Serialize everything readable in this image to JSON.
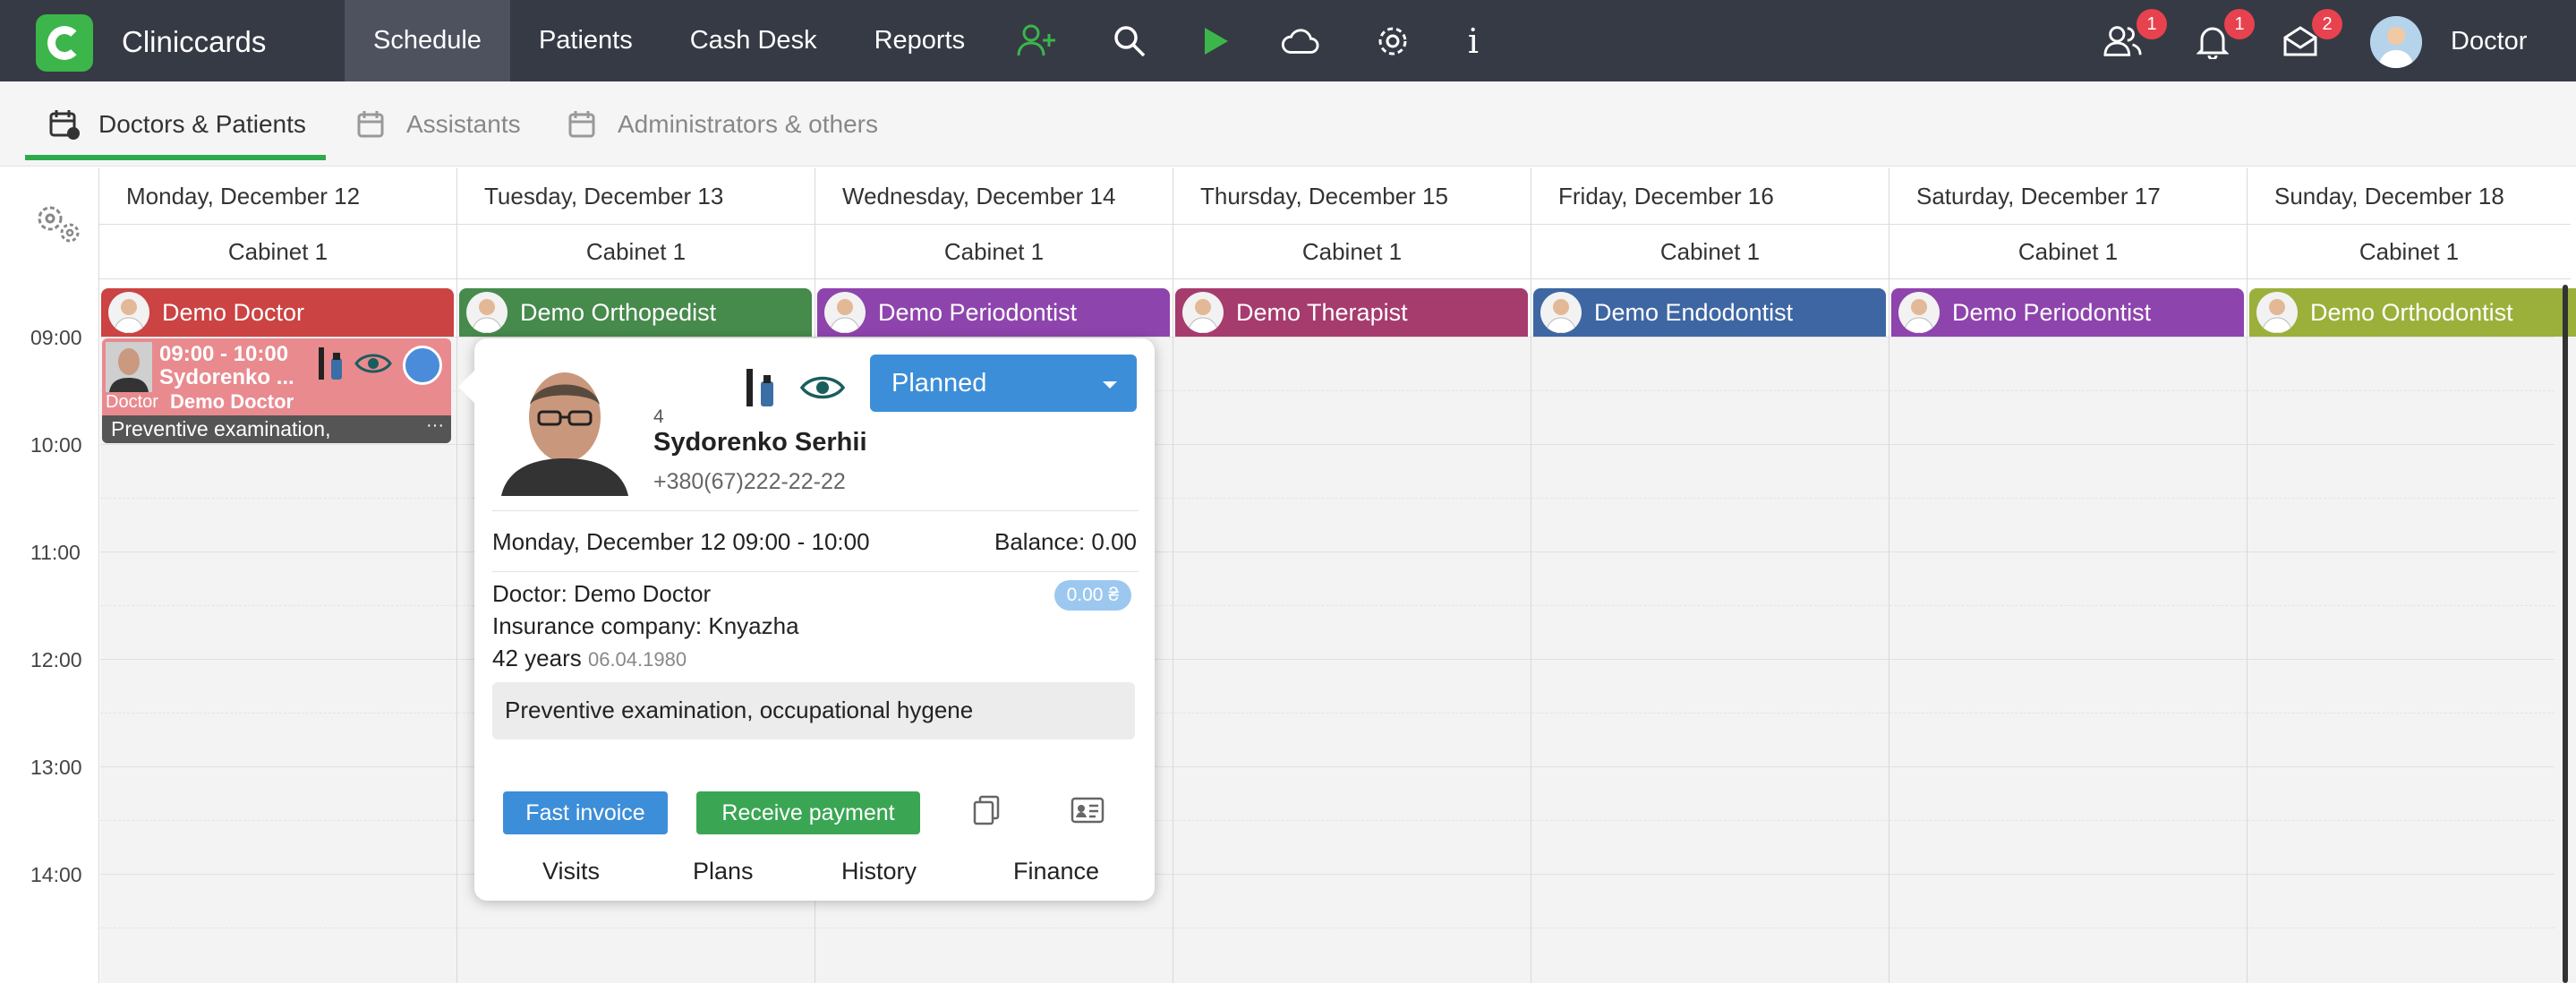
{
  "app": {
    "name": "Cliniccards",
    "user": "Doctor"
  },
  "nav": {
    "items": [
      "Schedule",
      "Patients",
      "Cash Desk",
      "Reports"
    ]
  },
  "badges": {
    "users": "1",
    "notifications": "1",
    "messages": "2"
  },
  "tabs": [
    "Doctors & Patients",
    "Assistants",
    "Administrators & others"
  ],
  "days": [
    {
      "date": "Monday, December 12",
      "cabinet": "Cabinet 1",
      "doctor": "Demo Doctor",
      "color": "#cb4343"
    },
    {
      "date": "Tuesday, December 13",
      "cabinet": "Cabinet 1",
      "doctor": "Demo Orthopedist",
      "color": "#468a4c"
    },
    {
      "date": "Wednesday, December 14",
      "cabinet": "Cabinet 1",
      "doctor": "Demo Periodontist",
      "color": "#8e44ad"
    },
    {
      "date": "Thursday, December 15",
      "cabinet": "Cabinet 1",
      "doctor": "Demo Therapist",
      "color": "#a63b6e"
    },
    {
      "date": "Friday, December 16",
      "cabinet": "Cabinet 1",
      "doctor": "Demo Endodontist",
      "color": "#3e66a3"
    },
    {
      "date": "Saturday, December 17",
      "cabinet": "Cabinet 1",
      "doctor": "Demo Periodontist",
      "color": "#8e44ad"
    },
    {
      "date": "Sunday, December 18",
      "cabinet": "Cabinet 1",
      "doctor": "Demo Orthodontist",
      "color": "#9bb03b"
    }
  ],
  "times": [
    "09:00",
    "10:00",
    "11:00",
    "12:00",
    "13:00",
    "14:00"
  ],
  "appointment": {
    "time": "09:00 - 10:00",
    "patient": "Sydorenko ...",
    "role": "Doctor",
    "doctor": "Demo Doctor",
    "note": "Preventive examination,",
    "more": "···"
  },
  "popup": {
    "number": "4",
    "name": "Sydorenko Serhii",
    "phone": "+380(67)222-22-22",
    "status": "Planned",
    "datetime": "Monday, December 12  09:00 - 10:00",
    "balance": "Balance: 0.00",
    "doctor": "Doctor: Demo Doctor",
    "amount": "0.00 ₴",
    "insurance": "Insurance company: Knyazha",
    "age": "42 years",
    "birth": "06.04.1980",
    "note": "Preventive examination, occupational hygene",
    "fast_invoice": "Fast invoice",
    "receive_payment": "Receive payment",
    "links": [
      "Visits",
      "Plans",
      "History",
      "Finance"
    ]
  }
}
